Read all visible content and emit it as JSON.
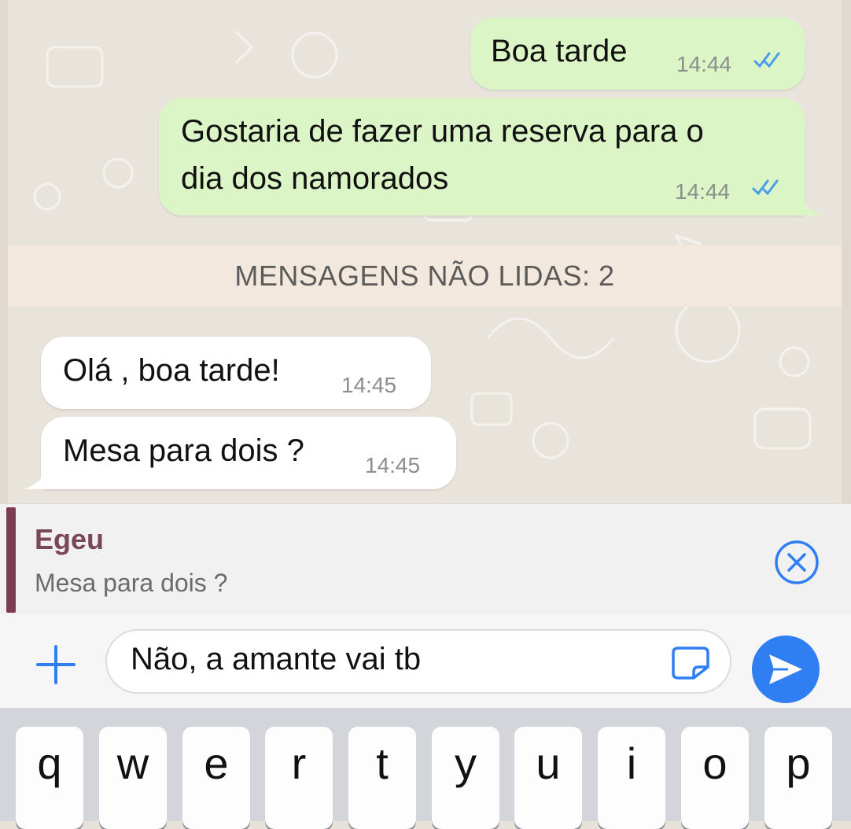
{
  "messages": [
    {
      "direction": "outgoing",
      "lines": [
        "Boa tarde"
      ],
      "time": "14:44",
      "status": "read"
    },
    {
      "direction": "outgoing",
      "lines": [
        "Gostaria de fazer uma reserva para o",
        "dia dos namorados"
      ],
      "time": "14:44",
      "status": "read"
    },
    {
      "direction": "incoming",
      "lines": [
        "Olá , boa tarde!"
      ],
      "time": "14:45"
    },
    {
      "direction": "incoming",
      "lines": [
        "Mesa para dois ?"
      ],
      "time": "14:45"
    }
  ],
  "unread_banner": "MENSAGENS NÃO LIDAS: 2",
  "reply": {
    "name": "Egeu",
    "snippet": "Mesa para dois ?"
  },
  "composer": {
    "value": "Não, a amante vai tb"
  },
  "keyboard": {
    "keys": [
      "q",
      "w",
      "e",
      "r",
      "t",
      "y",
      "u",
      "i",
      "o",
      "p"
    ]
  },
  "icons": {
    "attach": "plus-icon",
    "sticker": "sticker-icon",
    "send": "send-icon",
    "close_reply": "close-circle-icon",
    "read_receipt": "double-check-icon"
  },
  "colors": {
    "outgoing_bubble": "#dcf5c6",
    "incoming_bubble": "#ffffff",
    "read_ticks": "#4a9de8",
    "reply_accent": "#7a3d54",
    "send_button": "#2f7ff2",
    "ios_blue": "#2f7ff2"
  }
}
